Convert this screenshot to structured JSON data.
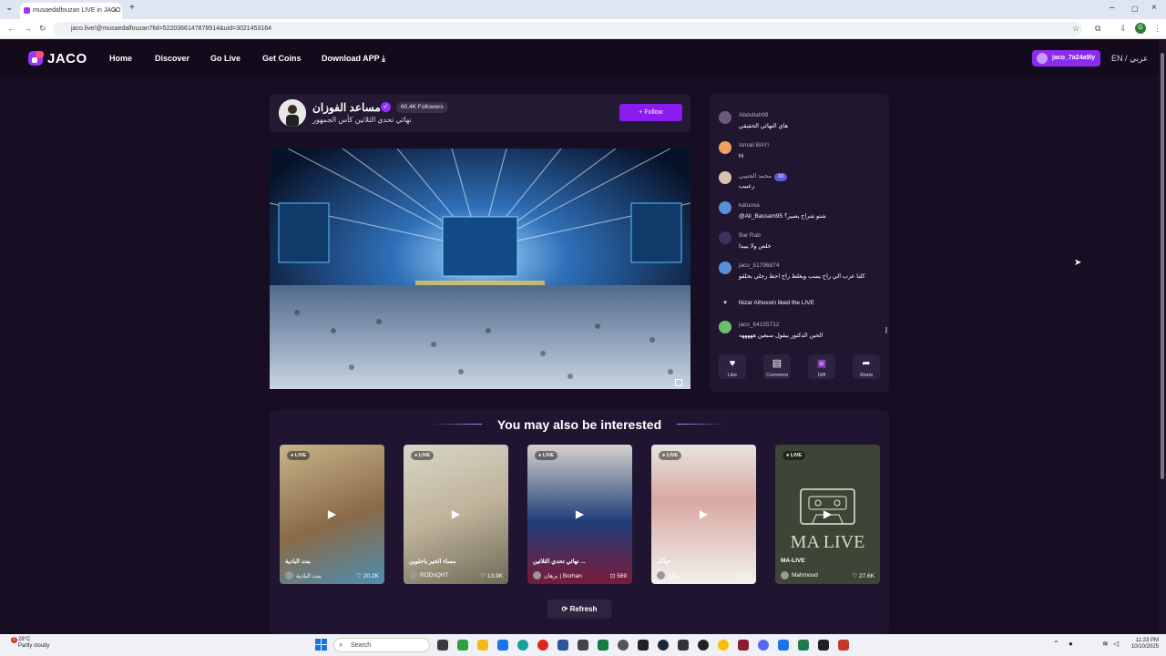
{
  "browser": {
    "tab_title": "musaedalfouzan LIVE in JACO",
    "url": "jaco.live/@musaedalfouzan?lid=5220366147878914&uid=3021453164",
    "profile_initial": "G"
  },
  "nav": {
    "logo": "JACO",
    "links": [
      "Home",
      "Discover",
      "Go Live",
      "Get Coins",
      "Download APP"
    ],
    "user": "jaco_7a24a9ly",
    "lang": "EN / عربي"
  },
  "streamer": {
    "name": "مساعد الفوزان",
    "followers": "60.4K Followers",
    "title": "نهائي تحدي الثلاثين كأس الجمهور",
    "follow_label": "Follow"
  },
  "chat": {
    "messages": [
      {
        "user": "Abdullah99",
        "text": "هاي النهائي الحقيقي"
      },
      {
        "user": "Ismail BAYI",
        "text": "hi"
      },
      {
        "user": "محمد الجنيبي",
        "text": "رعبيب",
        "level": "10"
      },
      {
        "user": "katuosa",
        "text": "@Ali_Bassam95 شتو شراح يصير؟"
      },
      {
        "user": "Bar Rab",
        "text": "خلص ولا يبيدا"
      },
      {
        "user": "jaco_51796874",
        "text": "كلنا عرب الي راح يسب ويغلط راح احط رجلي بحلقو"
      },
      {
        "user": "jaco_64155712",
        "text": "الحين الدكتور بيقول سبعين هههههه"
      }
    ],
    "like_notice": "Nizar Alhussin liked the LIVE",
    "actions": [
      "Like",
      "Comment",
      "Gift",
      "Share"
    ]
  },
  "recommendations": {
    "title": "You may also be interested",
    "live_badge": "LIVE",
    "cards": [
      {
        "title": "بنت البادية",
        "user": "بنت البادية",
        "count": "20.2K"
      },
      {
        "title": "مساء الخير ياحلوين",
        "user": "RODxQHT",
        "count": "13.9K"
      },
      {
        "title": "نهائي تحدي الثلاثين ...",
        "user": "برهان | Borhan",
        "count": "569"
      },
      {
        "title": "حياكم",
        "user": "وهاج",
        "count": "574"
      },
      {
        "title": "MA-LIVE",
        "user": "Mahmoud",
        "count": "27.6K"
      }
    ],
    "refresh_label": "Refresh"
  },
  "taskbar": {
    "weather_temp": "28°C",
    "weather_desc": "Partly cloudy",
    "search_placeholder": "Search",
    "time": "11:23 PM",
    "date": "10/10/2025",
    "notification_count": "2"
  }
}
